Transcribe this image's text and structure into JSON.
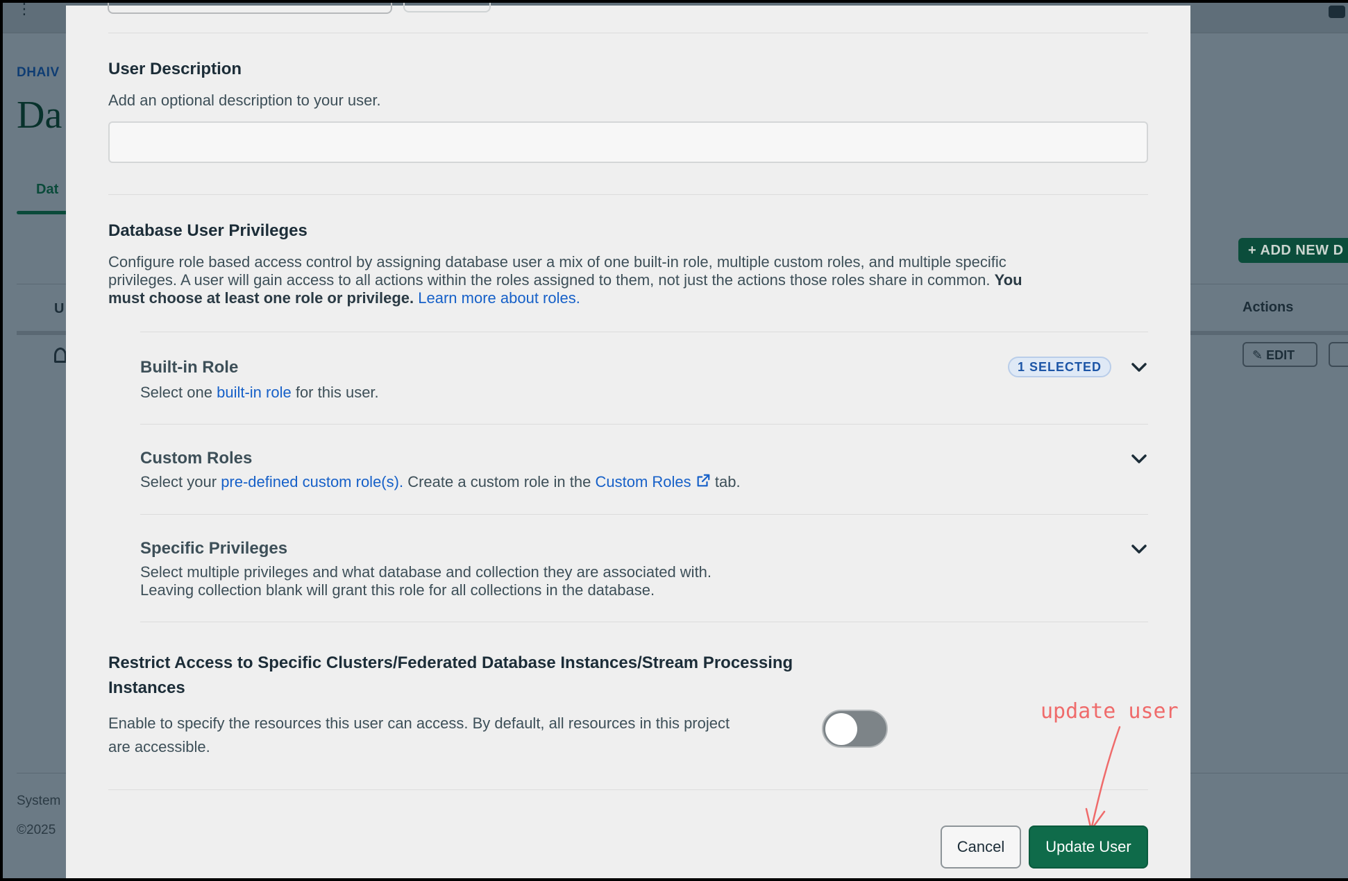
{
  "background": {
    "breadcrumb": "DHAIV",
    "title": "Da",
    "tab": "Dat",
    "table_header_first": "U",
    "add_button": "ADD NEW D",
    "actions_header": "Actions",
    "edit_button": "EDIT",
    "footer_system": "System",
    "footer_copyright": "©2025"
  },
  "modal": {
    "user_description": {
      "title": "User Description",
      "helper": "Add an optional description to your user.",
      "value": "",
      "placeholder": ""
    },
    "privileges": {
      "title": "Database User Privileges",
      "desc_part1": "Configure role based access control by assigning database user a mix of one built-in role, multiple custom roles, and multiple specific",
      "desc_part2": "privileges. A user will gain access to all actions within the roles assigned to them, not just the actions those roles share in common.",
      "desc_bold_a": "You",
      "desc_bold_b": "must choose at least one role or privilege.",
      "learn_more": "Learn more about roles."
    },
    "builtin_role": {
      "title": "Built-in Role",
      "desc_pre": "Select one",
      "desc_link": "built-in role",
      "desc_post": "for this user.",
      "badge": "1 SELECTED"
    },
    "custom_roles": {
      "title": "Custom Roles",
      "desc_pre": "Select your",
      "desc_link": "pre-defined custom role(s).",
      "desc_mid": "Create a custom role in the",
      "desc_link2": "Custom Roles",
      "desc_post": "tab."
    },
    "specific_privileges": {
      "title": "Specific Privileges",
      "line1": "Select multiple privileges and what database and collection they are associated with.",
      "line2": "Leaving collection blank will grant this role for all collections in the database."
    },
    "restrict": {
      "title_line1": "Restrict Access to Specific Clusters/Federated Database Instances/Stream Processing",
      "title_line2": "Instances",
      "desc_line1": "Enable to specify the resources this user can access. By default, all resources in this project",
      "desc_line2": "are accessible.",
      "toggle_on": false
    },
    "buttons": {
      "cancel": "Cancel",
      "update": "Update User"
    }
  },
  "annotation": {
    "text": "update user",
    "color": "#ef6b6b"
  },
  "colors": {
    "accent_green": "#0f6b4a",
    "link_blue": "#1660c8"
  }
}
